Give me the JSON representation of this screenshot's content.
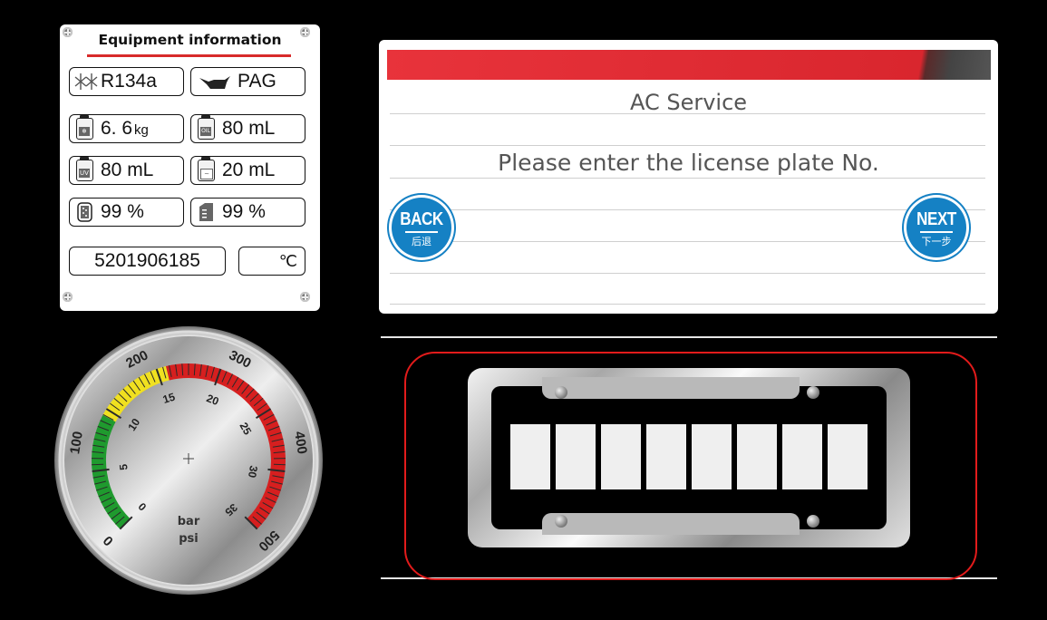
{
  "equipment": {
    "title": "Equipment information",
    "refrigerant": "R134a",
    "oil_type": "PAG",
    "refrigerant_weight": "6. 6",
    "refrigerant_weight_unit": "kg",
    "oil_volume": "80 mL",
    "uv_volume": "80 mL",
    "waste_volume": "20 mL",
    "filter_percent": "99 %",
    "tank_percent": "99 %",
    "serial": "5201906185",
    "temperature": "",
    "temperature_unit": "℃",
    "icons": [
      "snowflake-icon",
      "oil-can-icon",
      "refrigerant-bottle-icon",
      "oil-bottle-icon",
      "uv-bottle-icon",
      "waste-bottle-icon",
      "filter-icon",
      "tank-icon"
    ],
    "icon_tags": {
      "oil": "OIL",
      "uv": "UV"
    }
  },
  "gauge": {
    "unit_primary": "bar",
    "unit_secondary": "psi",
    "psi_labels": [
      "0",
      "100",
      "200",
      "300",
      "400",
      "500"
    ],
    "bar_labels": [
      "0",
      "5",
      "10",
      "15",
      "20",
      "25",
      "30",
      "35"
    ],
    "needle_value": null,
    "zone_colors": {
      "low": "#1f9a2e",
      "mid": "#f0e020",
      "high": "#d61f1f"
    }
  },
  "dialog": {
    "title": "AC Service",
    "prompt": "Please enter the license plate No.",
    "back_label": "BACK",
    "back_sub": "后退",
    "next_label": "NEXT",
    "next_sub": "下一步",
    "accent": "#e8333b",
    "button_color": "#1581c4"
  },
  "plate": {
    "slots": [
      "",
      "",
      "",
      "",
      "",
      "",
      "",
      ""
    ]
  }
}
